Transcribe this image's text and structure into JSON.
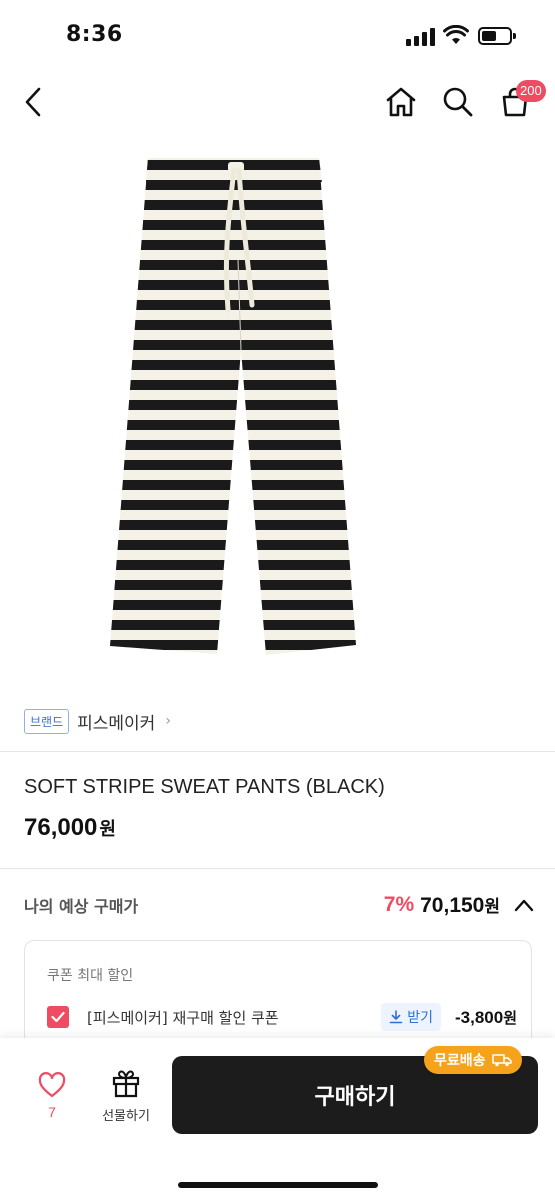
{
  "status_bar": {
    "time": "8:36"
  },
  "header": {
    "cart_count": "200"
  },
  "brand": {
    "tag": "브랜드",
    "name": "피스메이커",
    "chevron": "›"
  },
  "product": {
    "name": "SOFT STRIPE SWEAT PANTS (BLACK)",
    "price": "76,000",
    "currency": "원"
  },
  "estimate": {
    "label": "나의 예상 구매가",
    "discount": "7%",
    "price": "70,150",
    "currency": "원"
  },
  "coupon": {
    "title": "쿠폰 최대 할인",
    "item_name": "[피스메이커] 재구매 할인 쿠폰",
    "download_label": "받기",
    "amount": "-3,800",
    "currency": "원",
    "checked": true
  },
  "bottom": {
    "like_count": "7",
    "gift_label": "선물하기",
    "buy_label": "구매하기",
    "free_shipping": "무료배송"
  },
  "colors": {
    "accent_pink": "#ef4b63",
    "buy_bg": "#1c1c1c",
    "shipping_badge": "#f5a31a",
    "brand_blue": "#3a6ed3"
  },
  "icons": [
    "back-icon",
    "home-icon",
    "search-icon",
    "cart-icon",
    "chevron-up-icon",
    "check-icon",
    "download-icon",
    "heart-icon",
    "gift-icon",
    "truck-icon"
  ]
}
